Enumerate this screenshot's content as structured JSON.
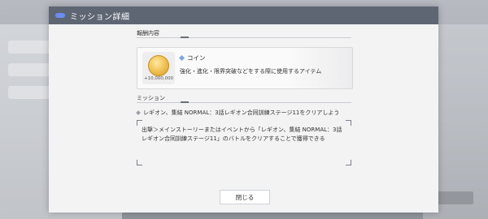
{
  "modal": {
    "title": "ミッション詳細",
    "reward_section_label": "報酬内容",
    "mission_section_label": "ミッション",
    "close_label": "閉じる"
  },
  "reward": {
    "icon": "gold-coin-icon",
    "amount": "+10,000,000",
    "name": "コイン",
    "description": "強化・進化・限界突破などをする際に使用するアイテム"
  },
  "mission": {
    "title": "レギオン、集結 NORMAL：3話レギオン合同訓練ステージ11をクリアしよう",
    "detail": "出撃＞メインストーリーまたはイベントから「レギオン、集結 NORMAL：3話レギオン合同訓練ステージ11」のバトルをクリアすることで獲得できる"
  },
  "colors": {
    "header_bg": "#5f6673",
    "accent": "#6a8df0"
  }
}
